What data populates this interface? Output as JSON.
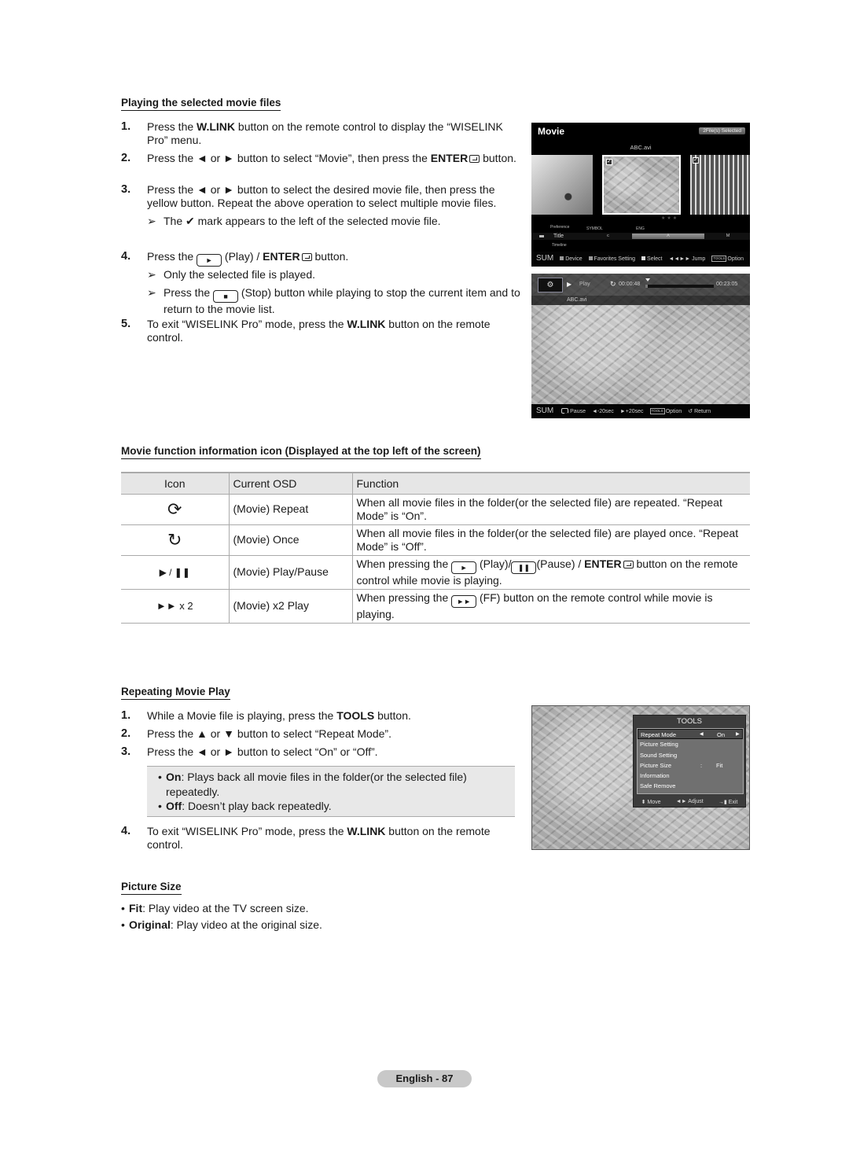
{
  "section1": {
    "title": "Playing the selected movie files",
    "steps": [
      {
        "num": "1.",
        "pre": "Press the ",
        "bold": "W.LINK",
        "post": " button on the remote control to display the “WISELINK Pro” menu."
      },
      {
        "num": "2.",
        "pre": "Press the ◄ or ► button to select “Movie”, then press the ",
        "bold": "ENTER",
        "post": " button."
      },
      {
        "num": "3.",
        "text": "Press the ◄ or ► button to select the desired movie file, then press the yellow button. Repeat the above operation to select multiple movie files."
      },
      {
        "num": "4.",
        "pre": "Press the ",
        "key_label": "Play",
        "mid": " (Play) / ",
        "bold": "ENTER",
        "post": " button."
      },
      {
        "num": "5.",
        "pre": "To exit “WISELINK Pro” mode, press the ",
        "bold": "W.LINK",
        "post": " button on the remote control."
      }
    ],
    "note_checkmark": {
      "pre": "The ",
      "glyph": "✔",
      "post": " mark appears to the left of the selected movie file."
    },
    "note_only_selected": "Only the selected file is played.",
    "note_stop": {
      "pre": "Press the ",
      "post": " (Stop) button while playing to stop the current item and to return to the movie list."
    },
    "arrow_glyph": "➢"
  },
  "tv_browser": {
    "title": "Movie",
    "badge": "2File(s) Selected",
    "filename": "ABC.avi",
    "checkmark": "✓",
    "stars": "★★★",
    "sort_up": "Preference",
    "sort_current": "Title",
    "sort_down": "Timeline",
    "index_labels": [
      "SYMBOL",
      "ENG"
    ],
    "index_segments": [
      "c",
      "A",
      "M"
    ],
    "footer": {
      "sum": "SUM",
      "items": [
        "Device",
        "Favorites Setting",
        "Select",
        "◄◄►► Jump",
        "Option"
      ],
      "tools_tag": "TOOLS"
    }
  },
  "tv_player": {
    "mode_icon": "⚙",
    "play_glyph": "▶",
    "state": "Play",
    "repeat_glyph": "↻",
    "elapsed": "00:00:48",
    "total": "00:23:05",
    "progress_fraction": 0.035,
    "filename": "ABC.avi",
    "footer": {
      "sum": "SUM",
      "pause": "Pause",
      "rewind": "◄-20sec",
      "forward": "►+20sec",
      "tools_tag": "TOOLS",
      "option": "Option",
      "return": "↺ Return"
    }
  },
  "section2": {
    "title": "Movie function information icon (Displayed at the top left of the screen)",
    "table": {
      "headers": [
        "Icon",
        "Current OSD",
        "Function"
      ],
      "rows": [
        {
          "icon": "⟳",
          "icon_name": "repeat-icon",
          "osd": "(Movie) Repeat",
          "function": "When all movie files in the folder(or the selected file) are repeated. “Repeat Mode” is “On”."
        },
        {
          "icon": "↻",
          "icon_name": "once-icon",
          "osd": "(Movie) Once",
          "function": "When all movie files in the folder(or the selected file) are played once. “Repeat Mode” is “Off”."
        },
        {
          "icon": "▶ / ❚❚",
          "icon_name": "play-pause-icon",
          "osd": "(Movie) Play/Pause",
          "function_pre": "When pressing the ",
          "function_mid1": " (Play)/",
          "function_mid2": "(Pause) / ",
          "function_bold": "ENTER",
          "function_post": " button on the remote control while movie is playing."
        },
        {
          "icon": "►► x 2",
          "icon_name": "fast-forward-icon",
          "osd": "(Movie) x2 Play",
          "function_pre": "When pressing the ",
          "function_post": " (FF) button on the remote control while movie is playing."
        }
      ]
    }
  },
  "section3": {
    "title": "Repeating Movie Play",
    "steps": [
      {
        "num": "1.",
        "pre": "While a Movie file is playing, press the ",
        "bold": "TOOLS",
        "post": " button."
      },
      {
        "num": "2.",
        "text": "Press the ▲ or ▼ button to select “Repeat Mode”."
      },
      {
        "num": "3.",
        "text": "Press the ◄ or ► button to select “On” or “Off”."
      },
      {
        "num": "4.",
        "pre": "To exit “WISELINK Pro” mode, press the ",
        "bold": "W.LINK",
        "post": " button on the remote control."
      }
    ],
    "options": [
      {
        "bold": "On",
        "text": ": Plays back all movie files in the folder(or the selected file) repeatedly."
      },
      {
        "bold": "Off",
        "text": ": Doesn’t play back repeatedly."
      }
    ]
  },
  "tools_menu": {
    "title": "TOOLS",
    "items": [
      {
        "label": "Repeat Mode",
        "value": "On",
        "selected": true
      },
      {
        "label": "Picture Setting"
      },
      {
        "label": "Sound Setting"
      },
      {
        "label": "Picture Size",
        "value": "Fit"
      },
      {
        "label": "Information"
      },
      {
        "label": "Safe Remove"
      }
    ],
    "footer": [
      "⬍ Move",
      "◄► Adjust",
      "→▮ Exit"
    ]
  },
  "section4": {
    "title": "Picture Size",
    "items": [
      {
        "bold": "Fit",
        "text": ": Play video at the TV screen size."
      },
      {
        "bold": "Original",
        "text": ": Play video at the original size."
      }
    ]
  },
  "footer": {
    "page_label": "English - 87"
  }
}
